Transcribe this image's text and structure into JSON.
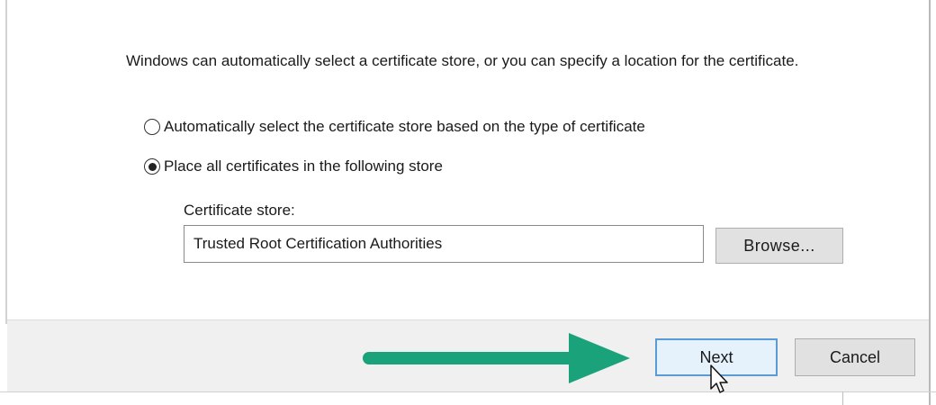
{
  "wizard": {
    "intro_text": "Windows can automatically select a certificate store, or you can specify a location for the certificate.",
    "options": [
      {
        "label": "Automatically select the certificate store based on the type of certificate",
        "selected": false
      },
      {
        "label": "Place all certificates in the following store",
        "selected": true
      }
    ],
    "store_label": "Certificate store:",
    "store_value": "Trusted Root Certification Authorities",
    "browse_label": "Browse...",
    "next_label": "Next",
    "cancel_label": "Cancel"
  },
  "colors": {
    "arrow": "#1aa27a",
    "next_border": "#5b9bd5",
    "footer_bg": "#f0f0f0"
  },
  "icons": [
    "radio-unselected-icon",
    "radio-selected-icon",
    "green-arrow-icon",
    "mouse-cursor-icon"
  ]
}
